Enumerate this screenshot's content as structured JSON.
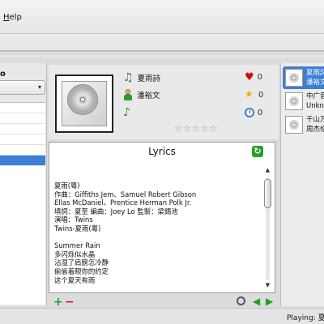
{
  "menu": {
    "help_label": "Help",
    "help_mnemonic": "H",
    "help_rest": "elp"
  },
  "left": {
    "title": "o",
    "combo_arrow": "▾"
  },
  "track": {
    "title": "夏雨詩",
    "artist": "潘裕文"
  },
  "stats": {
    "loves": "0",
    "rating_count": "0",
    "play_count": "0"
  },
  "rating": {
    "stars": "☆☆☆☆☆",
    "value_of_5": 0
  },
  "lyrics": {
    "title": "Lyrics",
    "lines": [
      "夏雨(粵)",
      "作曲：Giffiths Jem、Samuel Robert Gibson",
      "Ellas McDaniel、Prentice Herman Polk Jr.",
      "填詞：夏至 編曲：Joey Lo 監製：梁錫池",
      "演唱：Twins",
      "Twins-夏雨(粵)",
      "",
      "Summer Rain",
      "多闪烁似水晶",
      "沾湿了肩膀怎冷静",
      "偷偷着眼你的约定",
      "这个夏天有雨"
    ]
  },
  "playlist": [
    {
      "line1": "夏雨詩",
      "line2": "潘裕文",
      "selected": true
    },
    {
      "line1": "中广音",
      "line2": "Unknown",
      "selected": false
    },
    {
      "line1": "千山万",
      "line2": "周杰伦",
      "selected": false
    }
  ],
  "status": {
    "text": "Playing: 夏雨詩"
  },
  "icons": {
    "note": "music-note-icon",
    "person": "artist-icon",
    "album": "album-icon",
    "heart": "heart-icon",
    "star": "star-icon",
    "clock": "clock-icon",
    "refresh": "refresh-icon",
    "add": "plus-icon",
    "remove": "minus-icon",
    "zoom": "zoom-icon",
    "prev": "previous-icon",
    "next": "next-icon"
  },
  "colors": {
    "selection": "#3b7fd6",
    "heart": "#c91010",
    "green": "#23a023"
  }
}
